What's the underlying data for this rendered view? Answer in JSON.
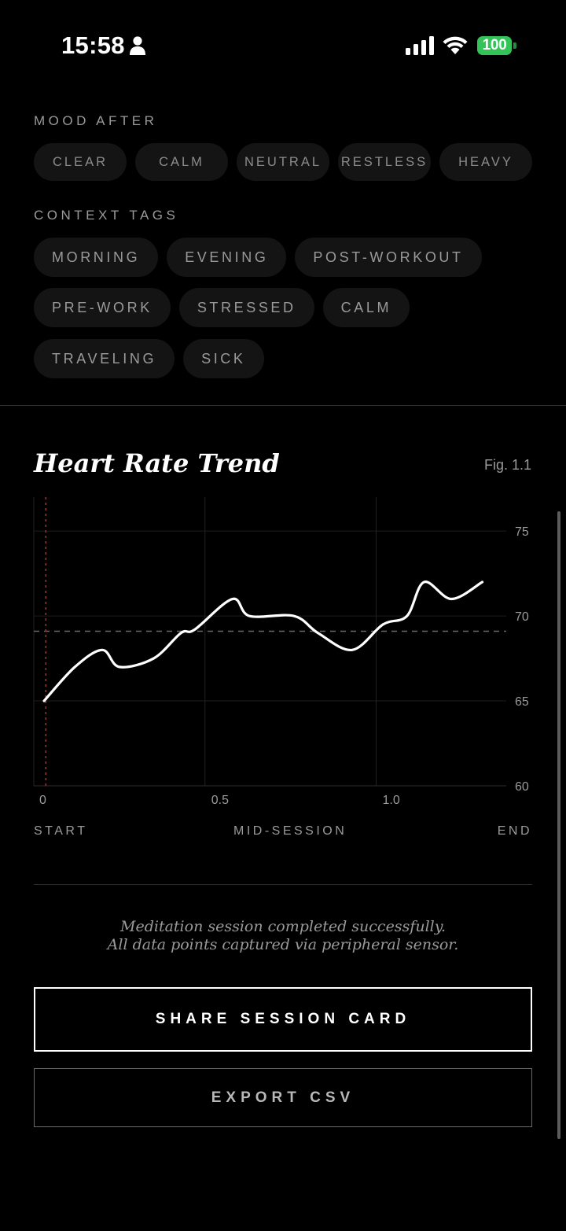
{
  "status_bar": {
    "time": "15:58",
    "battery": "100",
    "battery_color": "#33c359"
  },
  "mood_after": {
    "label": "MOOD AFTER",
    "options": [
      "CLEAR",
      "CALM",
      "NEUTRAL",
      "RESTLESS",
      "HEAVY"
    ]
  },
  "context_tags": {
    "label": "CONTEXT TAGS",
    "rows": [
      [
        "MORNING",
        "EVENING",
        "POST-WORKOUT"
      ],
      [
        "PRE-WORK",
        "STRESSED",
        "CALM"
      ],
      [
        "TRAVELING",
        "SICK"
      ]
    ]
  },
  "chart": {
    "title": "Heart Rate Trend",
    "figure_label": "Fig. 1.1",
    "phase_labels": [
      "START",
      "MID-SESSION",
      "END"
    ]
  },
  "chart_data": {
    "type": "line",
    "title": "Heart Rate Trend",
    "xlabel": "",
    "ylabel": "",
    "xlim": [
      0,
      1.38
    ],
    "ylim": [
      60,
      77
    ],
    "x_ticks": [
      0,
      0.5,
      1.0
    ],
    "x_tick_labels": [
      "0",
      "0.5",
      "1.0"
    ],
    "y_ticks": [
      60,
      65,
      70,
      75
    ],
    "y_tick_labels": [
      "60",
      "65",
      "70",
      "75"
    ],
    "grid": true,
    "reference_line": 69.1,
    "marker_line_x": 0.035,
    "series": [
      {
        "x": [
          0.03,
          0.12,
          0.2,
          0.25,
          0.35,
          0.43,
          0.47,
          0.58,
          0.63,
          0.76,
          0.83,
          0.93,
          1.02,
          1.09,
          1.14,
          1.22,
          1.31
        ],
        "y": [
          65,
          67,
          68,
          67,
          67.5,
          69,
          69.2,
          71,
          70,
          70,
          69,
          68,
          69.5,
          70,
          72,
          71,
          72
        ]
      }
    ]
  },
  "caption": {
    "line1": "Meditation session completed successfully.",
    "line2": "All data points captured via peripheral sensor."
  },
  "actions": {
    "share_label": "SHARE SESSION CARD",
    "export_label": "EXPORT CSV"
  }
}
